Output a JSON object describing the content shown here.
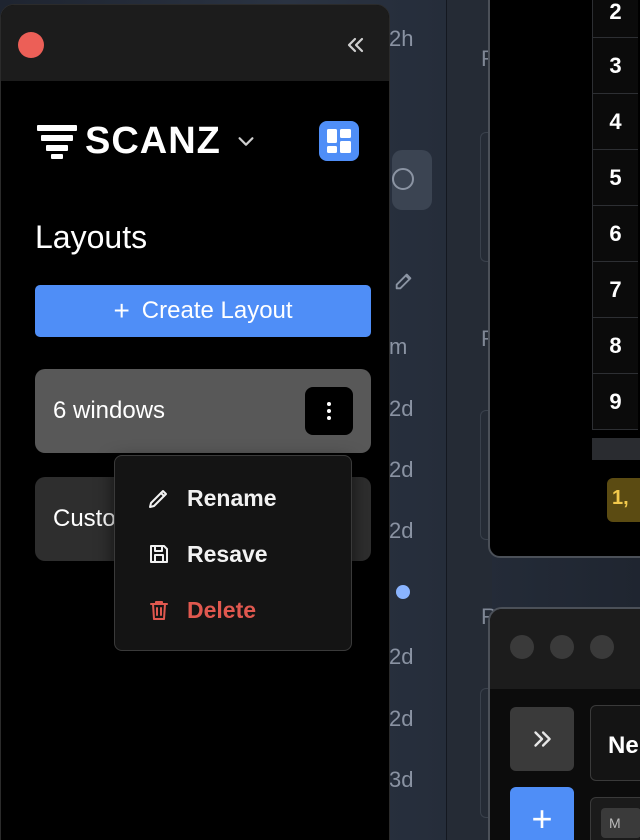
{
  "panel": {
    "brand": "SCANZ",
    "heading": "Layouts",
    "create_label": "Create Layout",
    "layouts": [
      {
        "label": "6 windows"
      },
      {
        "label": "Custo"
      }
    ],
    "menu": {
      "rename": "Rename",
      "resave": "Resave",
      "delete": "Delete"
    }
  },
  "background": {
    "column_labels": [
      "2h",
      "m",
      "2d",
      "2d",
      "2d",
      "2d",
      "2d",
      "3d"
    ],
    "mid_labels": [
      "R",
      "R",
      "R"
    ],
    "numbers": [
      "2",
      "3",
      "4",
      "5",
      "6",
      "7",
      "8",
      "9"
    ],
    "badge": "1,",
    "field_text": "Ne",
    "chip_text": "M"
  },
  "colors": {
    "accent": "#4f8ef7",
    "danger": "#e0584f",
    "close_light": "#ec5f57",
    "badge_text": "#f2c94c"
  }
}
